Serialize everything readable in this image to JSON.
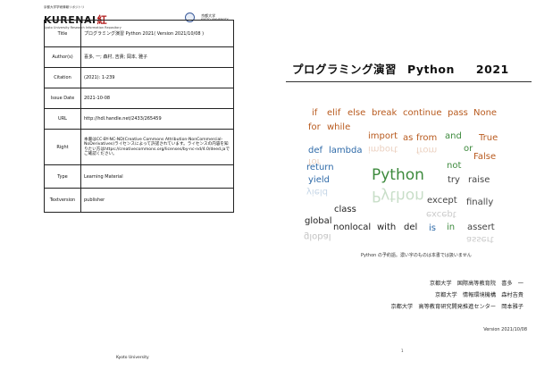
{
  "header": {
    "repo_name_ja": "京都大学学術情報リポジトリ",
    "repo_logo": "KURENAI",
    "repo_logo_char": "紅",
    "repo_subtitle": "Kyoto University Research Information Repository",
    "university_ja": "京都大学",
    "university_en": "KYOTO UNIVERSITY"
  },
  "metadata": [
    {
      "label": "Title",
      "value": "プログラミング演習 Python 2021( Version 2021/10/08 )"
    },
    {
      "label": "Author(s)",
      "value": "喜多, 一; 森村, 吉貴; 岡本, 雅子"
    },
    {
      "label": "Citation",
      "value": "(2021): 1-239"
    },
    {
      "label": "Issue Date",
      "value": "2021-10-08"
    },
    {
      "label": "URL",
      "value": "http://hdl.handle.net/2433/265459"
    },
    {
      "label": "Right",
      "value": "本書はCC-BY-NC-ND(Creative Commons Attribution-NonCommercial-NoDerivatives)ライセンスによって許諾されています。ライセンスの内容を知りたい方はhttps://creativecommons.org/licenses/by-nc-nd/4.0/deed.jaでご確認ください。"
    },
    {
      "label": "Type",
      "value": "Learning Material"
    },
    {
      "label": "Textversion",
      "value": "publisher"
    }
  ],
  "footer_left": "Kyoto University",
  "cover": {
    "title_ja": "プログラミング演習",
    "title_py": "Python",
    "title_year": "2021",
    "word_cloud": [
      {
        "text": "if",
        "color": "#b85a1e"
      },
      {
        "text": "elif",
        "color": "#b85a1e"
      },
      {
        "text": "else",
        "color": "#b85a1e"
      },
      {
        "text": "break",
        "color": "#b85a1e"
      },
      {
        "text": "continue",
        "color": "#b85a1e"
      },
      {
        "text": "pass",
        "color": "#b85a1e"
      },
      {
        "text": "None",
        "color": "#b85a1e"
      },
      {
        "text": "for",
        "color": "#b85a1e"
      },
      {
        "text": "while",
        "color": "#b85a1e"
      },
      {
        "text": "import",
        "color": "#b85a1e"
      },
      {
        "text": "as",
        "color": "#b85a1e"
      },
      {
        "text": "from",
        "color": "#b85a1e"
      },
      {
        "text": "and",
        "color": "#3d8a3d"
      },
      {
        "text": "True",
        "color": "#b85a1e"
      },
      {
        "text": "def",
        "color": "#2e6aa8"
      },
      {
        "text": "lambda",
        "color": "#2e6aa8"
      },
      {
        "text": "or",
        "color": "#3d8a3d"
      },
      {
        "text": "return",
        "color": "#2e6aa8"
      },
      {
        "text": "False",
        "color": "#b85a1e"
      },
      {
        "text": "not",
        "color": "#3d8a3d"
      },
      {
        "text": "Python",
        "color": "#3d8a3d"
      },
      {
        "text": "yield",
        "color": "#2e6aa8"
      },
      {
        "text": "try",
        "color": "#444444"
      },
      {
        "text": "raise",
        "color": "#444444"
      },
      {
        "text": "except",
        "color": "#444444"
      },
      {
        "text": "finally",
        "color": "#444444"
      },
      {
        "text": "class",
        "color": "#222222"
      },
      {
        "text": "global",
        "color": "#222222"
      },
      {
        "text": "nonlocal",
        "color": "#222222"
      },
      {
        "text": "with",
        "color": "#222222"
      },
      {
        "text": "del",
        "color": "#222222"
      },
      {
        "text": "is",
        "color": "#2e6aa8"
      },
      {
        "text": "in",
        "color": "#3d8a3d"
      },
      {
        "text": "assert",
        "color": "#444444"
      }
    ],
    "caption": "Python の予約語。濃い字のものは本書では扱いません",
    "affiliations": [
      "京都大学　国際高等教育院　喜多　一",
      "京都大学　情報環境機構　森村吉貴",
      "京都大学　高等教育研究開発推進センター　岡本雅子"
    ],
    "version": "Version 2021/10/08"
  },
  "page_number": "1"
}
